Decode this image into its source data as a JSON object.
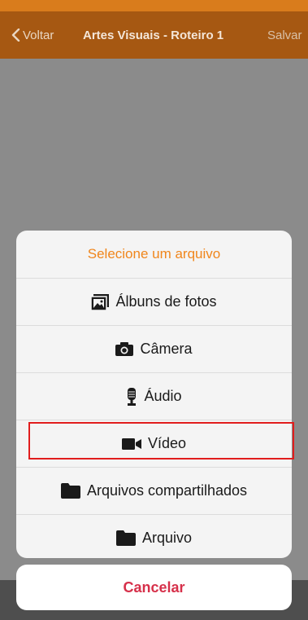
{
  "colors": {
    "accent_orange": "#f0861c",
    "navbar_brown": "#a65812",
    "cancel_red": "#d6304a",
    "highlight_red": "#e11d1d"
  },
  "navbar": {
    "back_label": "Voltar",
    "title": "Artes Visuais - Roteiro 1",
    "save_label": "Salvar"
  },
  "sheet": {
    "header": "Selecione um arquivo",
    "options": [
      {
        "label": "Álbuns de fotos",
        "icon": "photo-album-icon"
      },
      {
        "label": "Câmera",
        "icon": "camera-icon"
      },
      {
        "label": "Áudio",
        "icon": "microphone-icon"
      },
      {
        "label": "Vídeo",
        "icon": "video-camera-icon"
      },
      {
        "label": "Arquivos compartilhados",
        "icon": "folder-icon"
      },
      {
        "label": "Arquivo",
        "icon": "folder-icon"
      }
    ],
    "cancel_label": "Cancelar"
  }
}
